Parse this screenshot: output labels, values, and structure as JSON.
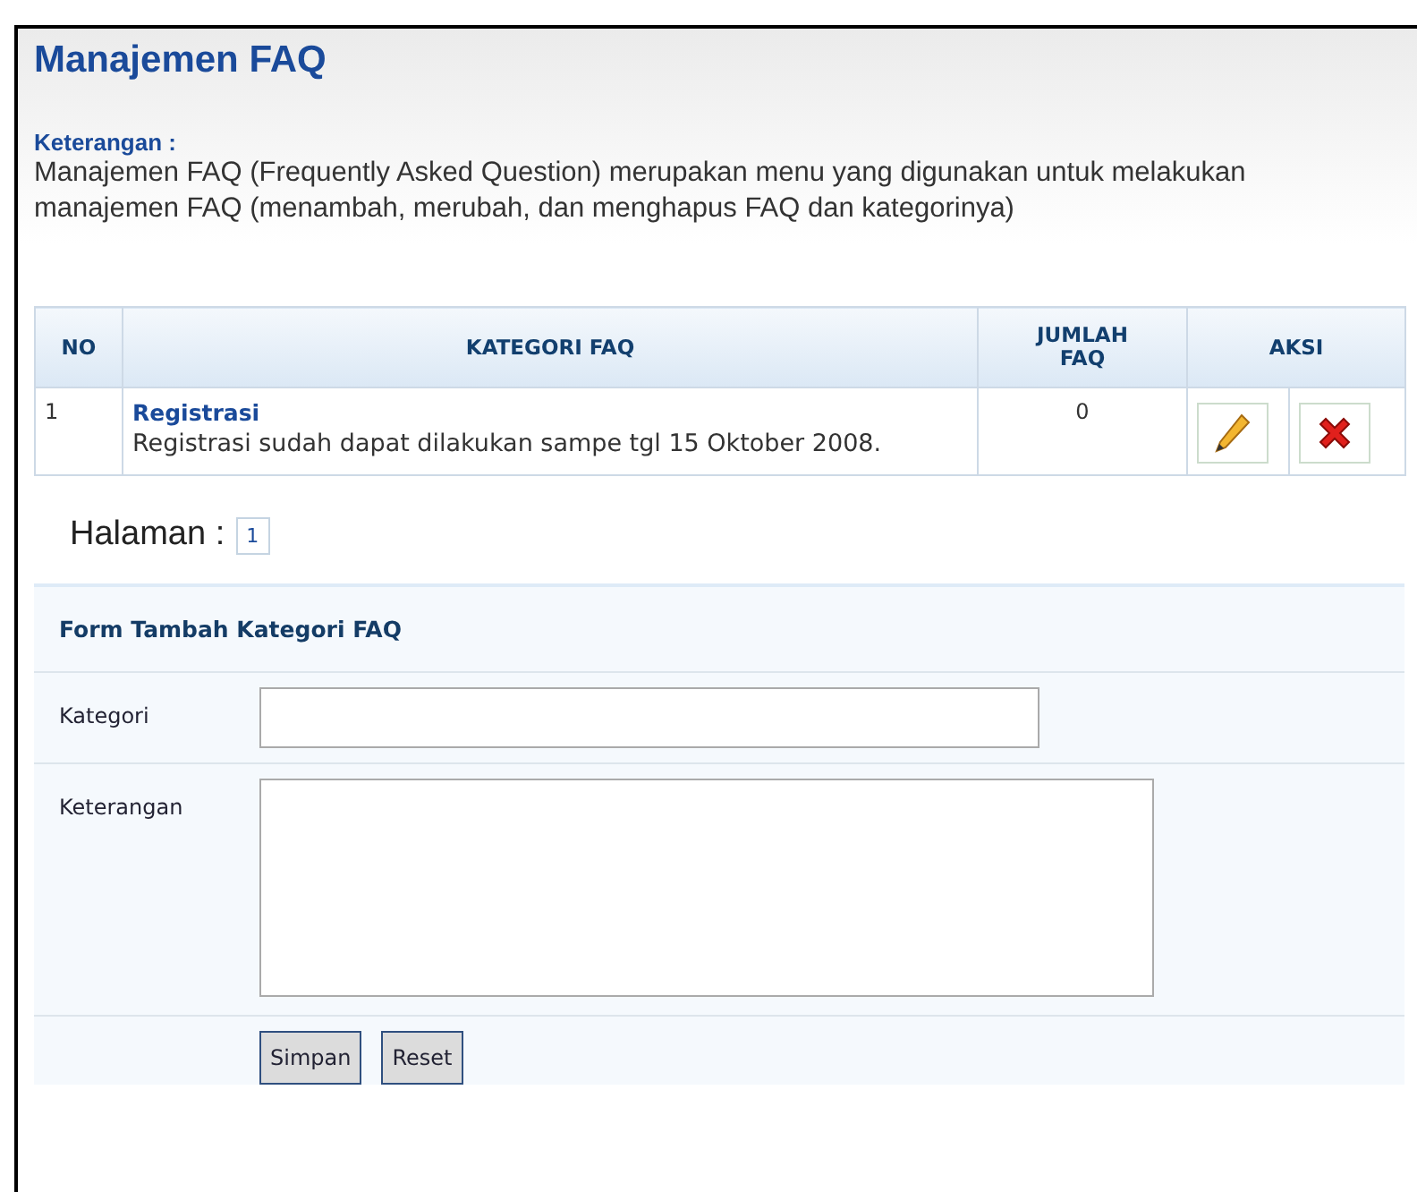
{
  "title": "Manajemen FAQ",
  "description": {
    "label": "Keterangan :",
    "text": "Manajemen FAQ (Frequently Asked Question) merupakan menu yang digunakan untuk melakukan manajemen FAQ (menambah, merubah, dan menghapus FAQ dan kategorinya)"
  },
  "table": {
    "columns": [
      "NO",
      "KATEGORI FAQ",
      "JUMLAH FAQ",
      "AKSI"
    ],
    "rows": [
      {
        "no": "1",
        "category": "Registrasi",
        "description": "Registrasi sudah dapat dilakukan sampe tgl 15 Oktober 2008.",
        "count": "0"
      }
    ]
  },
  "pagination": {
    "label": "Halaman :",
    "pages": [
      {
        "label": "1",
        "selected": true
      }
    ]
  },
  "form": {
    "title": "Form Tambah Kategori FAQ",
    "fields": [
      {
        "label": "Kategori",
        "kind": "input"
      },
      {
        "label": "Keterangan",
        "kind": "textarea"
      }
    ],
    "buttons": [
      "Simpan",
      "Reset"
    ]
  }
}
